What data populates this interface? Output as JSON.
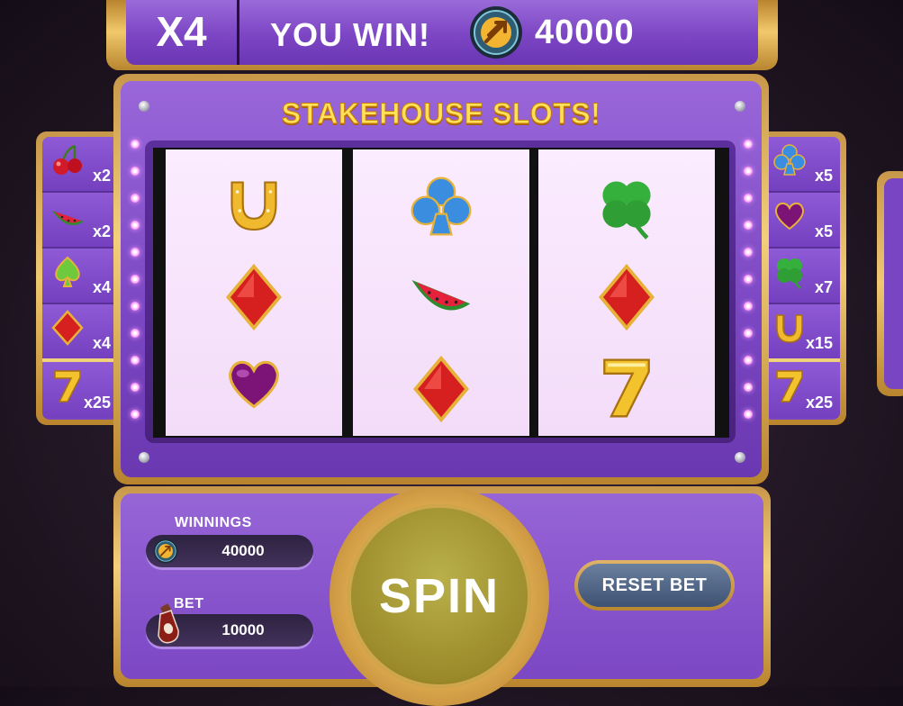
{
  "banner": {
    "multiplier": "X4",
    "win_label": "YOU WIN!",
    "win_amount": "40000",
    "coin_icon": "gold-coin-icon"
  },
  "machine": {
    "title": "STAKEHOUSE SLOTS!"
  },
  "paytable_left": [
    {
      "icon": "cherry-icon",
      "multiplier": "x2"
    },
    {
      "icon": "watermelon-icon",
      "multiplier": "x2"
    },
    {
      "icon": "spade-icon",
      "multiplier": "x4"
    },
    {
      "icon": "diamond-icon",
      "multiplier": "x4"
    },
    {
      "icon": "seven-icon",
      "multiplier": "x25"
    }
  ],
  "paytable_right": [
    {
      "icon": "club-icon",
      "multiplier": "x5"
    },
    {
      "icon": "heart-icon",
      "multiplier": "x5"
    },
    {
      "icon": "clover-icon",
      "multiplier": "x7"
    },
    {
      "icon": "horseshoe-icon",
      "multiplier": "x15"
    },
    {
      "icon": "seven-icon",
      "multiplier": "x25"
    }
  ],
  "reels": [
    [
      "horseshoe-icon",
      "diamond-icon",
      "heart-icon"
    ],
    [
      "club-icon",
      "watermelon-icon",
      "diamond-icon"
    ],
    [
      "clover-icon",
      "diamond-icon",
      "seven-icon"
    ]
  ],
  "controls": {
    "winnings_label": "WINNINGS",
    "winnings_value": "40000",
    "bet_label": "BET",
    "bet_value": "10000",
    "bet_icon": "ketchup-bottle-icon",
    "spin_label": "SPIN",
    "reset_label": "RESET BET"
  },
  "colors": {
    "accent_purple": "#7a45c2",
    "gold": "#f0c872",
    "title_yellow": "#ffe15a"
  }
}
